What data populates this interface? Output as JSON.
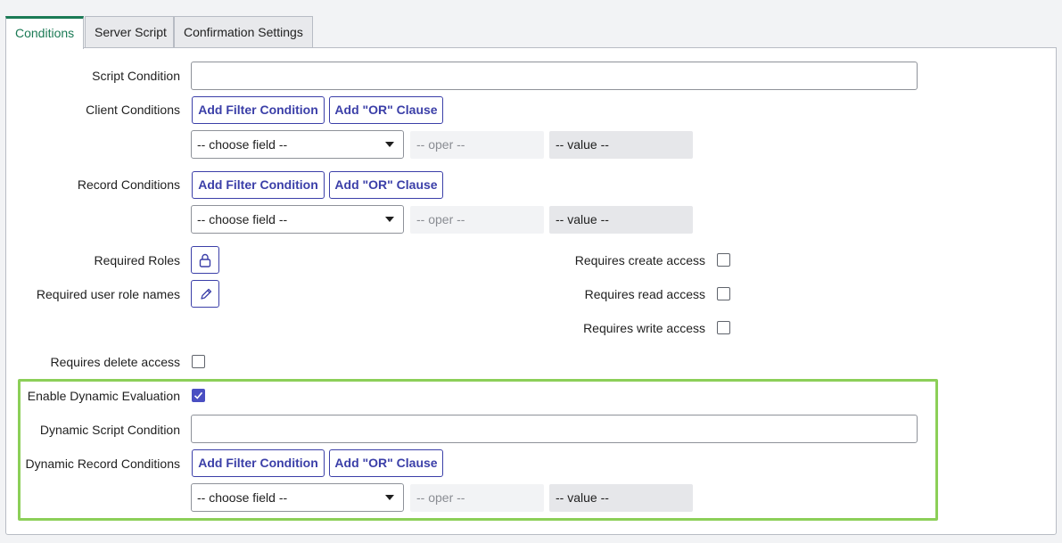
{
  "tabs": [
    {
      "label": "Conditions",
      "active": true
    },
    {
      "label": "Server Script",
      "active": false
    },
    {
      "label": "Confirmation Settings",
      "active": false
    }
  ],
  "form": {
    "script_condition_label": "Script Condition",
    "client_conditions_label": "Client Conditions",
    "record_conditions_label": "Record Conditions",
    "required_roles_label": "Required Roles",
    "required_user_role_names_label": "Required user role names",
    "requires_create_label": "Requires create access",
    "requires_read_label": "Requires read access",
    "requires_write_label": "Requires write access",
    "requires_delete_label": "Requires delete access",
    "enable_dynamic_label": "Enable Dynamic Evaluation",
    "dynamic_script_label": "Dynamic Script Condition",
    "dynamic_record_label": "Dynamic Record Conditions",
    "enable_dynamic_checked": true,
    "requires_create_checked": false,
    "requires_read_checked": false,
    "requires_write_checked": false,
    "requires_delete_checked": false
  },
  "filter": {
    "add_filter_label": "Add Filter Condition",
    "add_or_label": "Add \"OR\" Clause",
    "choose_field": "-- choose field --",
    "oper": "-- oper --",
    "value": "-- value --"
  },
  "icons": {
    "roles": "lock-icon",
    "role_names": "pencil-icon",
    "caret": "chevron-down-icon",
    "check": "check-icon"
  },
  "colors": {
    "accent_tab": "#1b7a55",
    "button": "#3b3fa8",
    "checkbox_checked": "#4a4fc2",
    "highlight_box": "#8ccf58"
  }
}
